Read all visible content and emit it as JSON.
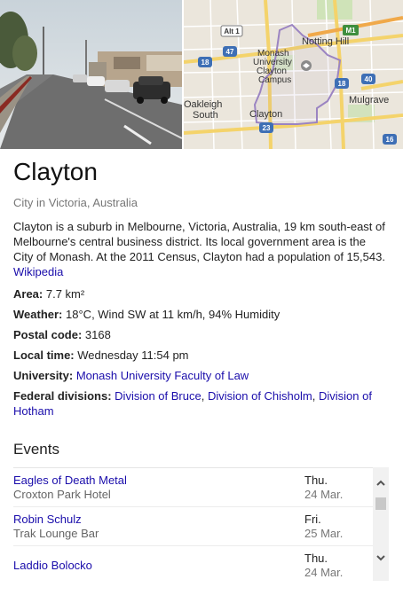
{
  "header": {
    "title": "Clayton",
    "subtitle": "City in Victoria, Australia"
  },
  "map": {
    "labels": {
      "notting_hill": "Notting Hill",
      "monash1": "Monash",
      "monash2": "University",
      "monash3": "Clayton",
      "monash4": "Campus",
      "oakleigh1": "Oakleigh",
      "oakleigh2": "South",
      "clayton": "Clayton",
      "mulgrave": "Mulgrave"
    },
    "shields": {
      "alt1": "Alt 1",
      "m1": "M1",
      "r47": "47",
      "r18a": "18",
      "r18b": "18",
      "r40": "40",
      "r23": "23",
      "r16": "16"
    }
  },
  "description": {
    "text": "Clayton is a suburb in Melbourne, Victoria, Australia, 19 km south-east of Melbourne's central business district. Its local government area is the City of Monash. At the 2011 Census, Clayton had a population of 15,543.",
    "source": "Wikipedia"
  },
  "facts": {
    "area_label": "Area:",
    "area_value": "7.7 km²",
    "weather_label": "Weather:",
    "weather_value": "18°C, Wind SW at 11 km/h, 94% Humidity",
    "postal_label": "Postal code:",
    "postal_value": "3168",
    "time_label": "Local time:",
    "time_value": "Wednesday 11:54 pm",
    "university_label": "University:",
    "university_value": "Monash University Faculty of Law",
    "federal_label": "Federal divisions:",
    "federal_1": "Division of Bruce",
    "federal_sep1": ",",
    "federal_2": "Division of Chisholm",
    "federal_sep2": ",",
    "federal_3": "Division of Hotham"
  },
  "events": {
    "title": "Events",
    "items": [
      {
        "name": "Eagles of Death Metal",
        "venue": "Croxton Park Hotel",
        "day": "Thu.",
        "date": "24 Mar."
      },
      {
        "name": "Robin Schulz",
        "venue": "Trak Lounge Bar",
        "day": "Fri.",
        "date": "25 Mar."
      },
      {
        "name": "Laddio Bolocko",
        "venue": "",
        "day": "Thu.",
        "date": "24 Mar."
      }
    ]
  },
  "icons": {
    "scroll_up": "scroll-up-icon",
    "scroll_down": "scroll-down-icon",
    "university_marker": "university-marker-icon"
  },
  "colors": {
    "link": "#1a0dab",
    "boundary": "#9b84c2"
  }
}
